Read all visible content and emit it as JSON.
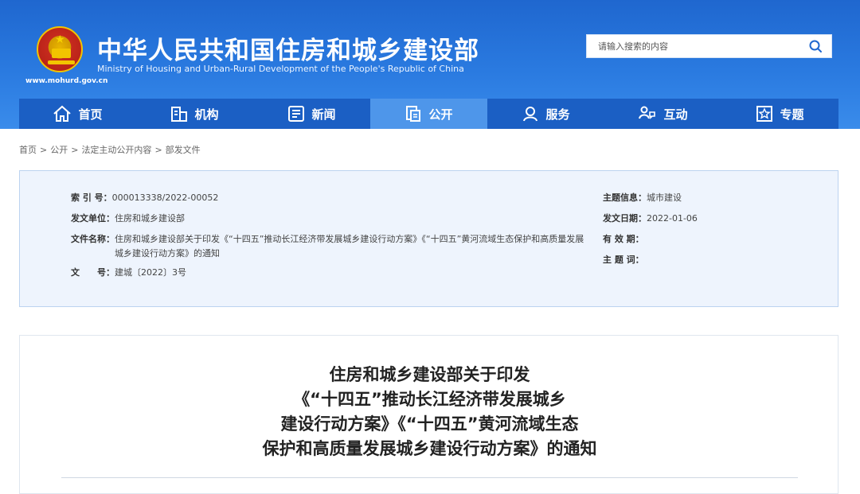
{
  "header": {
    "title": "中华人民共和国住房和城乡建设部",
    "subtitle": "Ministry of Housing and Urban-Rural Development of the People's Republic of China",
    "url": "www.mohurd.gov.cn",
    "search_placeholder": "请输入搜索的内容",
    "brand_color": "#1f67cf"
  },
  "nav": {
    "items": [
      {
        "label": "首页",
        "icon": "home-icon"
      },
      {
        "label": "机构",
        "icon": "building-icon"
      },
      {
        "label": "新闻",
        "icon": "newspaper-icon"
      },
      {
        "label": "公开",
        "icon": "document-icon",
        "active": true
      },
      {
        "label": "服务",
        "icon": "service-person-icon"
      },
      {
        "label": "互动",
        "icon": "interaction-icon"
      },
      {
        "label": "专题",
        "icon": "star-badge-icon"
      }
    ]
  },
  "breadcrumb": {
    "items": [
      "首页",
      "公开",
      "法定主动公开内容",
      "部发文件"
    ],
    "separator": ">"
  },
  "meta": {
    "index_label": "索 引 号：",
    "index_value": "000013338/2022-00052",
    "unit_label": "发文单位：",
    "unit_value": "住房和城乡建设部",
    "name_label": "文件名称：",
    "name_value": "住房和城乡建设部关于印发《“十四五”推动长江经济带发展城乡建设行动方案》《“十四五”黄河流域生态保护和高质量发展城乡建设行动方案》的通知",
    "docno_label": "文　　号：",
    "docno_value": "建城〔2022〕3号",
    "topic_label": "主题信息：",
    "topic_value": "城市建设",
    "date_label": "发文日期：",
    "date_value": "2022-01-06",
    "valid_label": "有 效 期：",
    "valid_value": "",
    "keywords_label": "主 题 词：",
    "keywords_value": ""
  },
  "article": {
    "title_lines": [
      "住房和城乡建设部关于印发",
      "《“十四五”推动长江经济带发展城乡",
      "建设行动方案》《“十四五”黄河流域生态",
      "保护和高质量发展城乡建设行动方案》的通知"
    ]
  }
}
